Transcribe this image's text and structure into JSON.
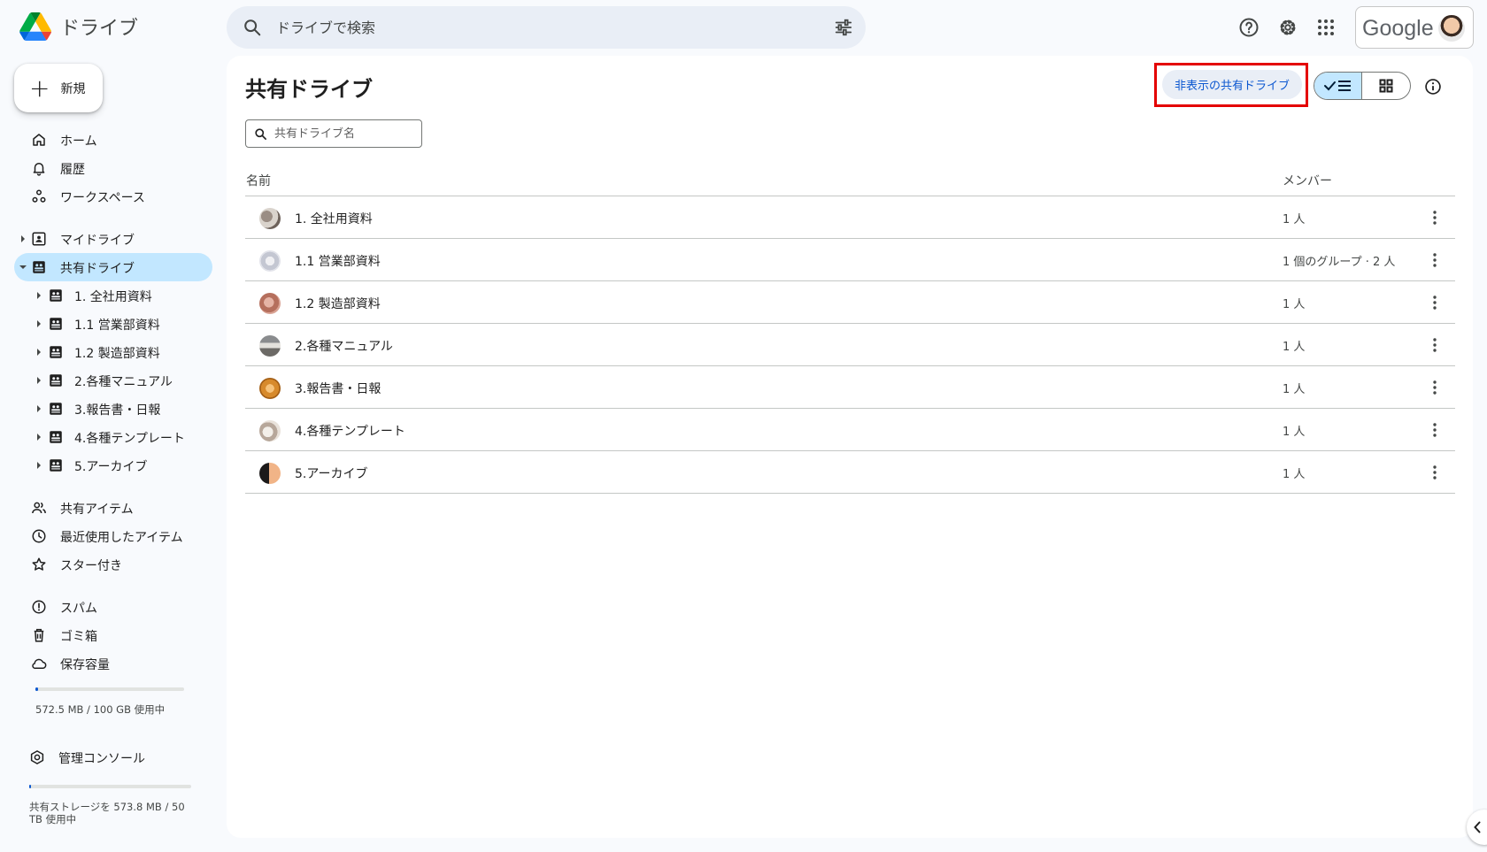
{
  "header": {
    "app_name": "ドライブ",
    "search_placeholder": "ドライブで検索",
    "google_label": "Google"
  },
  "sidebar": {
    "new_label": "新規",
    "nav": [
      {
        "label": "ホーム",
        "icon": "home-icon"
      },
      {
        "label": "履歴",
        "icon": "bell-icon"
      },
      {
        "label": "ワークスペース",
        "icon": "workspace-icon"
      }
    ],
    "my_drive": "マイドライブ",
    "shared_drives": "共有ドライブ",
    "shared_drive_children": [
      "1. 全社用資料",
      "1.1 営業部資料",
      "1.2 製造部資料",
      "2.各種マニュアル",
      "3.報告書・日報",
      "4.各種テンプレート",
      "5.アーカイブ"
    ],
    "nav2": [
      {
        "label": "共有アイテム",
        "icon": "people-icon"
      },
      {
        "label": "最近使用したアイテム",
        "icon": "clock-icon"
      },
      {
        "label": "スター付き",
        "icon": "star-icon"
      }
    ],
    "nav3": [
      {
        "label": "スパム",
        "icon": "spam-icon"
      },
      {
        "label": "ゴミ箱",
        "icon": "trash-icon"
      },
      {
        "label": "保存容量",
        "icon": "cloud-icon"
      }
    ],
    "storage_used": "572.5 MB / 100 GB 使用中",
    "storage_fraction": 0.006,
    "admin_console": "管理コンソール",
    "shared_storage_line1": "共有ストレージを 573.8 MB / 50",
    "shared_storage_line2": "TB 使用中",
    "shared_storage_fraction": 1e-05
  },
  "main": {
    "title": "共有ドライブ",
    "hidden_drives_button": "非表示の共有ドライブ",
    "filter_placeholder": "共有ドライブ名",
    "columns": {
      "name": "名前",
      "members": "メンバー"
    },
    "rows": [
      {
        "name": "1. 全社用資料",
        "members": "1 人"
      },
      {
        "name": "1.1 営業部資料",
        "members": "1 個のグループ · 2 人"
      },
      {
        "name": "1.2 製造部資料",
        "members": "1 人"
      },
      {
        "name": "2.各種マニュアル",
        "members": "1 人"
      },
      {
        "name": "3.報告書・日報",
        "members": "1 人"
      },
      {
        "name": "4.各種テンプレート",
        "members": "1 人"
      },
      {
        "name": "5.アーカイブ",
        "members": "1 人"
      }
    ]
  },
  "colors": {
    "accent": "#0b57d0",
    "active_nav": "#c2e7ff",
    "highlight_box": "#e40000",
    "background": "#f8fafd"
  }
}
